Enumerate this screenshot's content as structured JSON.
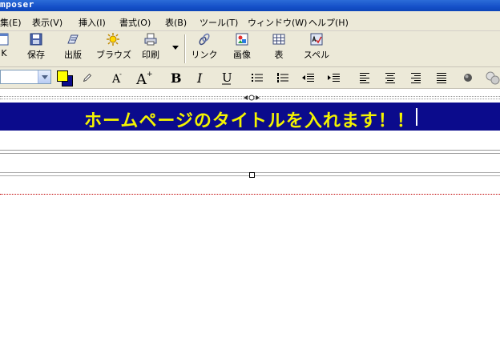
{
  "window": {
    "title": "mposer"
  },
  "menu": [
    "集(E)",
    "表示(V)",
    "挿入(I)",
    "書式(O)",
    "表(B)",
    "ツール(T)",
    "ウィンドウ(W)",
    "ヘルプ(H)"
  ],
  "toolbar": {
    "partial_label": "K",
    "save_label": "保存",
    "publish_label": "出版",
    "browse_label": "ブラウズ",
    "print_label": "印刷",
    "link_label": "リンク",
    "image_label": "画像",
    "table_label": "表",
    "spell_label": "スペル"
  },
  "format": {
    "text_color": "#ffff00",
    "background_color": "#0b0b8c"
  },
  "document": {
    "title_text": "ホームページのタイトルを入れます！！"
  }
}
